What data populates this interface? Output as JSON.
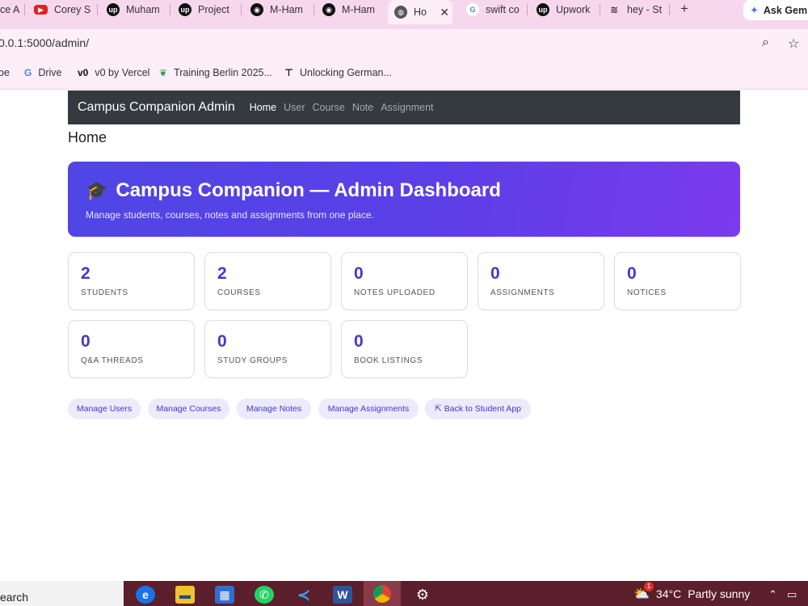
{
  "browser": {
    "tabs": [
      {
        "label": "ce A",
        "icon": "page-icon"
      },
      {
        "label": "Corey S",
        "icon": "youtube-icon"
      },
      {
        "label": "Muham",
        "icon": "upwork-icon"
      },
      {
        "label": "Project",
        "icon": "upwork-icon"
      },
      {
        "label": "M-Ham",
        "icon": "github-icon"
      },
      {
        "label": "M-Ham",
        "icon": "github-icon"
      },
      {
        "label": "Ho",
        "icon": "globe-icon",
        "active": true
      },
      {
        "label": "swift co",
        "icon": "google-icon"
      },
      {
        "label": "Upwork",
        "icon": "upwork-icon"
      },
      {
        "label": "hey - St",
        "icon": "stackoverflow-icon"
      }
    ],
    "new_tab": "+",
    "ask_gemini": "Ask Gem",
    "url": "0.0.1:5000/admin/",
    "bookmarks": [
      {
        "label": "be"
      },
      {
        "label": "Drive",
        "icon": "google-icon"
      },
      {
        "label": "v0 by Vercel",
        "icon": "v0-icon"
      },
      {
        "label": "Training Berlin 2025...",
        "icon": "leaf-icon"
      },
      {
        "label": "Unlocking German...",
        "icon": "pin-icon"
      }
    ]
  },
  "navbar": {
    "brand": "Campus Companion Admin",
    "links": [
      "Home",
      "User",
      "Course",
      "Note",
      "Assignment"
    ]
  },
  "page_title": "Home",
  "hero": {
    "title": "Campus Companion — Admin Dashboard",
    "subtitle": "Manage students, courses, notes and assignments from one place."
  },
  "stats": [
    {
      "value": "2",
      "label": "STUDENTS"
    },
    {
      "value": "2",
      "label": "COURSES"
    },
    {
      "value": "0",
      "label": "NOTES UPLOADED"
    },
    {
      "value": "0",
      "label": "ASSIGNMENTS"
    },
    {
      "value": "0",
      "label": "NOTICES"
    },
    {
      "value": "0",
      "label": "Q&A THREADS"
    },
    {
      "value": "0",
      "label": "STUDY GROUPS"
    },
    {
      "value": "0",
      "label": "BOOK LISTINGS"
    }
  ],
  "actions": [
    "Manage Users",
    "Manage Courses",
    "Manage Notes",
    "Manage Assignments",
    "⇱ Back to Student App"
  ],
  "taskbar": {
    "search": "earch",
    "weather_temp": "34°C",
    "weather_desc": "Partly sunny",
    "weather_badge": "1"
  },
  "colors": {
    "accent": "#4338ca",
    "hero_start": "#4f46e5",
    "hero_end": "#7b3aed",
    "navbar": "#343a40"
  }
}
